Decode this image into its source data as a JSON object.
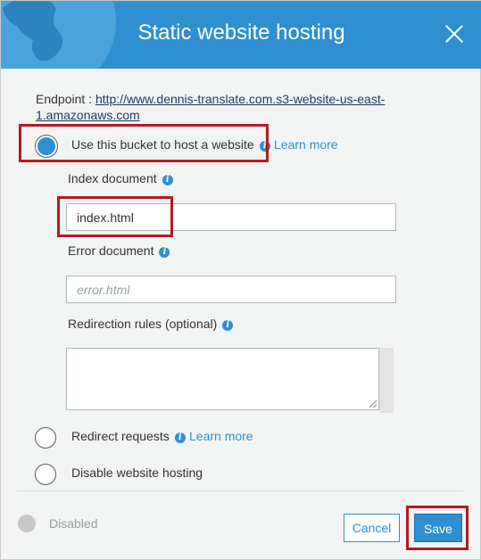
{
  "dialog": {
    "title": "Static website hosting"
  },
  "endpoint": {
    "label": "Endpoint : ",
    "url": "http://www.dennis-translate.com.s3-website-us-east-1.amazonaws.com"
  },
  "options": {
    "host": {
      "label": "Use this bucket to host a website",
      "link": "Learn more",
      "selected": true
    },
    "redirect": {
      "label": "Redirect requests",
      "link": "Learn more",
      "selected": false
    },
    "disable": {
      "label": "Disable website hosting",
      "selected": false
    }
  },
  "fields": {
    "index": {
      "label": "Index document",
      "value": "index.html"
    },
    "error": {
      "label": "Error document",
      "placeholder": "error.html"
    },
    "redirection": {
      "label": "Redirection rules (optional)",
      "value": ""
    }
  },
  "footer": {
    "status": "Disabled",
    "cancel": "Cancel",
    "save": "Save"
  },
  "colors": {
    "accent": "#2e90d1",
    "highlight": "#b01c25"
  }
}
